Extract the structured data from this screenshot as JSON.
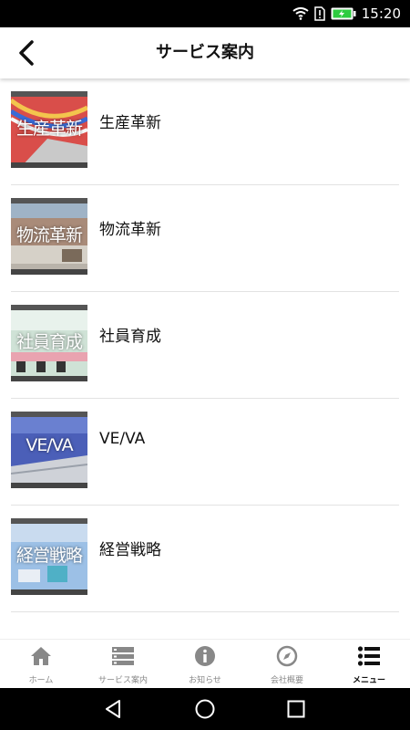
{
  "status": {
    "time": "15:20"
  },
  "header": {
    "title": "サービス案内"
  },
  "services": [
    {
      "thumb_text": "生産革新",
      "label": "生産革新"
    },
    {
      "thumb_text": "物流革新",
      "label": "物流革新"
    },
    {
      "thumb_text": "社員育成",
      "label": "社員育成"
    },
    {
      "thumb_text": "VE/VA",
      "label": "VE/VA"
    },
    {
      "thumb_text": "経営戦略",
      "label": "経営戦略"
    }
  ],
  "tabs": [
    {
      "label": "ホーム",
      "icon": "home-icon"
    },
    {
      "label": "サービス案内",
      "icon": "list-card-icon"
    },
    {
      "label": "お知らせ",
      "icon": "info-icon"
    },
    {
      "label": "会社概要",
      "icon": "compass-icon"
    },
    {
      "label": "メニュー",
      "icon": "menu-list-icon",
      "active": true
    }
  ],
  "colors": {
    "accent": "#111111",
    "inactive": "#888888",
    "divider": "#e2e2e2"
  }
}
